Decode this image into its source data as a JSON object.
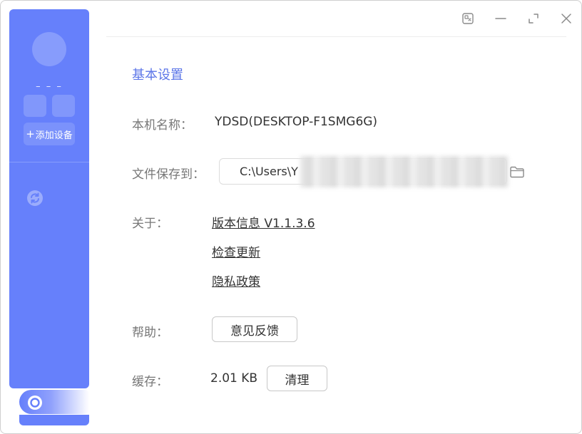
{
  "sidebar": {
    "user_name": "– – –",
    "add_device_label": "添加设备",
    "add_device_icon": "plus-icon",
    "sync_icon": "sync-icon",
    "settings_icon": "settings-icon",
    "accent_color": "#6680fb"
  },
  "titlebar": {
    "icons": [
      "pin-icon",
      "minimize-icon",
      "maximize-icon",
      "close-icon"
    ]
  },
  "settings": {
    "section_title": "基本设置",
    "device_name_label": "本机名称：",
    "device_name_value": "YDSD(DESKTOP-F1SMG6G)",
    "save_path_label": "文件保存到：",
    "save_path_value": "C:\\Users\\Y",
    "about_label": "关于：",
    "about_links": {
      "version": "版本信息 V1.1.3.6",
      "check_update": "检查更新",
      "privacy": "隐私政策"
    },
    "help_label": "帮助：",
    "feedback_button": "意见反馈",
    "cache_label": "缓存：",
    "cache_value": "2.01 KB",
    "clear_button": "清理"
  }
}
